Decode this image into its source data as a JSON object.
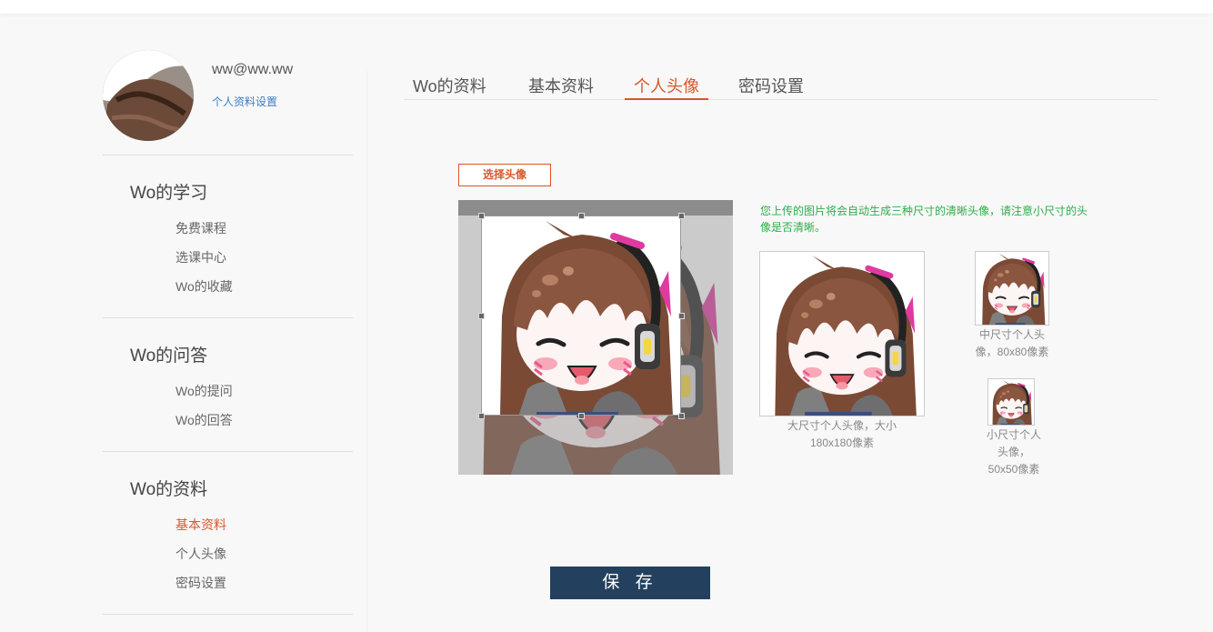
{
  "user": {
    "email": "ww@ww.ww",
    "settings_link": "个人资料设置"
  },
  "sidebar": {
    "sections": [
      {
        "title": "Wo的学习",
        "items": [
          "免费课程",
          "选课中心",
          "Wo的收藏"
        ]
      },
      {
        "title": "Wo的问答",
        "items": [
          "Wo的提问",
          "Wo的回答"
        ]
      },
      {
        "title": "Wo的资料",
        "items": [
          "基本资料",
          "个人头像",
          "密码设置"
        ]
      }
    ],
    "active_item": "基本资料"
  },
  "tabs": [
    "Wo的资料",
    "基本资料",
    "个人头像",
    "密码设置"
  ],
  "active_tab": "个人头像",
  "upload": {
    "choose_label": "选择头像",
    "hint": "您上传的图片将会自动生成三种尺寸的清晰头像，请注意小尺寸的头像是否清晰。"
  },
  "previews": {
    "large_caption": "大尺寸个人头像，大小180x180像素",
    "medium_caption": "中尺寸个人头像，80x80像素",
    "small_caption": "小尺寸个人头像，50x50像素"
  },
  "save_label": "保 存",
  "colors": {
    "accent": "#d9562b",
    "link": "#3a7fc4",
    "hint": "#2cae49",
    "save_button": "#23415e"
  },
  "icons": {
    "avatar": "user-avatar-image",
    "crop_image": "anime-girl-headphones-image"
  }
}
